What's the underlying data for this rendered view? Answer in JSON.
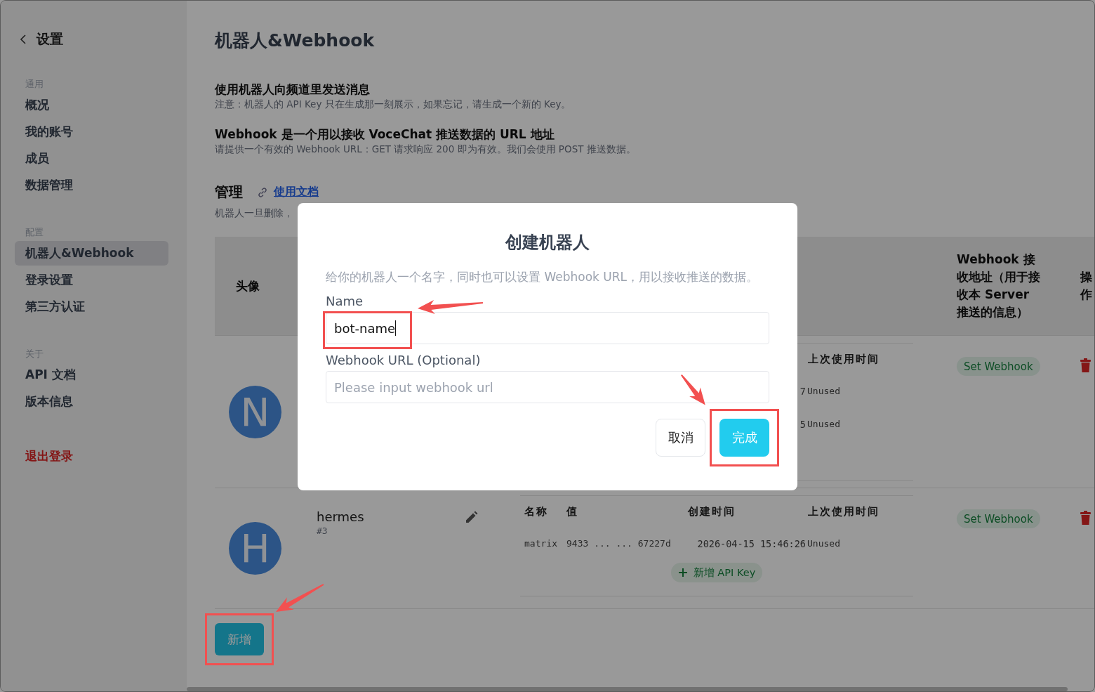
{
  "sidebar": {
    "back": {
      "label": "设置"
    },
    "groups": [
      {
        "label": "通用",
        "items": [
          {
            "label": "概况",
            "selected": false
          },
          {
            "label": "我的账号",
            "selected": false
          },
          {
            "label": "成员",
            "selected": false
          },
          {
            "label": "数据管理",
            "selected": false
          }
        ]
      },
      {
        "label": "配置",
        "items": [
          {
            "label": "机器人&Webhook",
            "selected": true
          },
          {
            "label": "登录设置",
            "selected": false
          },
          {
            "label": "第三方认证",
            "selected": false
          }
        ]
      },
      {
        "label": "关于",
        "items": [
          {
            "label": "API 文档",
            "selected": false
          },
          {
            "label": "版本信息",
            "selected": false
          }
        ]
      }
    ],
    "logout": "退出登录"
  },
  "page": {
    "title": "机器人&Webhook",
    "sections": [
      {
        "title": "使用机器人向频道里发送消息",
        "description": "注意：机器人的 API Key 只在生成那一刻展示，如果忘记，请生成一个新的 Key。"
      },
      {
        "title": "Webhook 是一个用以接收 VoceChat 推送数据的 URL 地址",
        "description": "请提供一个有效的 Webhook URL：GET 请求响应 200 即为有效。我们会使用 POST 推送数据。"
      }
    ],
    "manage": {
      "title": "管理",
      "docs_link": "使用文档",
      "description": "机器人一旦删除，"
    }
  },
  "table": {
    "columns": [
      "头像",
      "Webhook 接收地址（用于接收本 Server 推送的信息）",
      "操作"
    ],
    "rows": [
      {
        "avatar": "N",
        "keys": {
          "headers": {
            "last_used": "上次使用时间"
          },
          "rows": [
            {
              "created": "7",
              "last_used": "Unused"
            },
            {
              "created": "5",
              "last_used": "Unused"
            }
          ]
        },
        "webhook_button": "Set Webhook"
      },
      {
        "avatar": "H",
        "name": "hermes",
        "id": "#3",
        "keys": {
          "headers": {
            "name": "名称",
            "value": "值",
            "created": "创建时间",
            "last_used": "上次使用时间"
          },
          "rows": [
            {
              "name": "matrix",
              "value": "9433 ... ... 67227d",
              "created": "2026-04-15 15:46:26",
              "last_used": "Unused"
            }
          ]
        },
        "add_key_button": "新增 API Key",
        "webhook_button": "Set Webhook"
      }
    ]
  },
  "add_button": {
    "label": "新增",
    "highlighted": true
  },
  "dialog": {
    "title": "创建机器人",
    "description": "给你的机器人一个名字，同时也可以设置 Webhook URL，用以接收推送的数据。",
    "fields": [
      {
        "label": "Name",
        "value": "bot-name",
        "highlighted": true
      },
      {
        "label": "Webhook URL (Optional)",
        "placeholder": "Please input webhook url"
      }
    ],
    "buttons": [
      {
        "label": "取消",
        "kind": "secondary"
      },
      {
        "label": "完成",
        "kind": "primary",
        "highlighted": true
      }
    ]
  }
}
